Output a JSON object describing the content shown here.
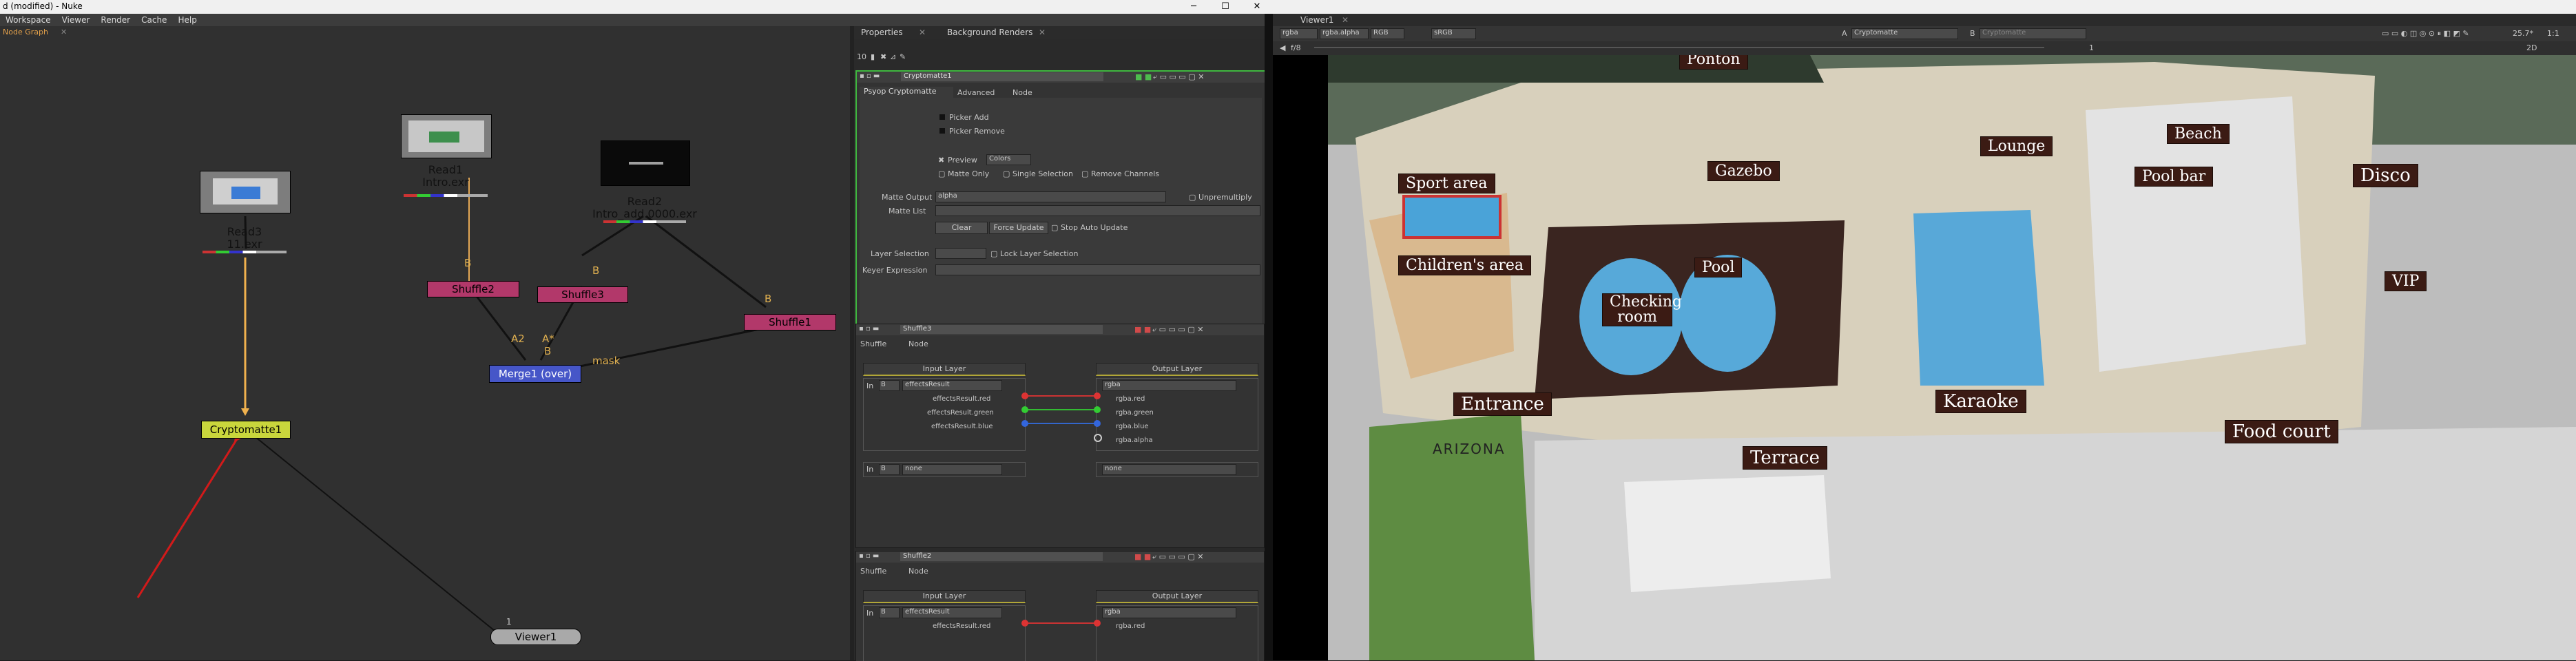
{
  "window": {
    "title": "d (modified) - Nuke",
    "min": "─",
    "max": "☐",
    "close": "✕"
  },
  "menu": [
    "Workspace",
    "Viewer",
    "Render",
    "Cache",
    "Help"
  ],
  "node_graph": {
    "tab": "Node Graph",
    "nodes": {
      "read1": {
        "label1": "Read1",
        "label2": "Intro.exr"
      },
      "read2": {
        "label1": "Read2",
        "label2": "Intro_add.0000.exr"
      },
      "read3": {
        "label1": "Read3",
        "label2": "11.exr"
      },
      "shuffle2": "Shuffle2",
      "shuffle3": "Shuffle3",
      "shuffle1": "Shuffle1",
      "merge1": "Merge1 (over)",
      "cryptomatte1": "Cryptomatte1",
      "viewer1": "Viewer1"
    },
    "edge_labels": {
      "b1": "B",
      "b2": "B",
      "b3": "B",
      "a2": "A2",
      "astar": "A*",
      "b4": "B",
      "mask": "mask",
      "one": "1"
    }
  },
  "properties": {
    "tabs": [
      "Properties",
      "Background Renders"
    ],
    "count": "10",
    "crypto": {
      "name": "Cryptomatte1",
      "tabs": [
        "Psyop Cryptomatte",
        "Advanced",
        "Node"
      ],
      "picker_add": "Picker Add",
      "picker_remove": "Picker Remove",
      "preview_label": "Preview",
      "preview_value": "Colors",
      "matte_only": "Matte Only",
      "single_selection": "Single Selection",
      "remove_channels": "Remove Channels",
      "matte_output_label": "Matte Output",
      "matte_output_value": "alpha",
      "unpremultiply": "Unpremultiply",
      "matte_list_label": "Matte List",
      "clear": "Clear",
      "force_update": "Force Update",
      "stop_auto_update": "Stop Auto Update",
      "layer_selection_label": "Layer Selection",
      "lock_layer_selection": "Lock Layer Selection",
      "keyer_expression_label": "Keyer Expression"
    },
    "shuffle3": {
      "name": "Shuffle3",
      "tabs": [
        "Shuffle",
        "Node"
      ],
      "input_layer": "Input Layer",
      "output_layer": "Output Layer",
      "in_label": "In",
      "in_index": "B",
      "in_value": "effectsResult",
      "out_value": "rgba",
      "channels_in": [
        "effectsResult.red",
        "effectsResult.green",
        "effectsResult.blue"
      ],
      "channels_out": [
        "rgba.red",
        "rgba.green",
        "rgba.blue",
        "rgba.alpha"
      ],
      "in2_index": "B",
      "in2_value": "none",
      "out2_value": "none"
    },
    "shuffle2": {
      "name": "Shuffle2",
      "tabs": [
        "Shuffle",
        "Node"
      ],
      "input_layer": "Input Layer",
      "output_layer": "Output Layer",
      "in_label": "In",
      "in_index": "B",
      "in_value": "effectsResult",
      "out_value": "rgba",
      "channel_in": "effectsResult.red",
      "channel_out": "rgba.red"
    }
  },
  "viewer": {
    "tab": "Viewer1",
    "channels": "rgba",
    "alpha": "rgba.alpha",
    "colorspace": "RGB",
    "lut": "sRGB",
    "a_input": "Cryptomatte",
    "b_input": "Cryptomatte",
    "frame": "f/8",
    "zoom": "25.7*",
    "ratio": "1:1",
    "mode": "2D",
    "y": "1",
    "labels": [
      "Ponton",
      "Beach",
      "Lounge",
      "Gazebo",
      "Sport area",
      "Pool bar",
      "Disco",
      "Children's area",
      "Pool",
      "VIP",
      "Checking room",
      "Entrance",
      "Karaoke",
      "Terrace",
      "Food court",
      "ARIZONA"
    ]
  }
}
